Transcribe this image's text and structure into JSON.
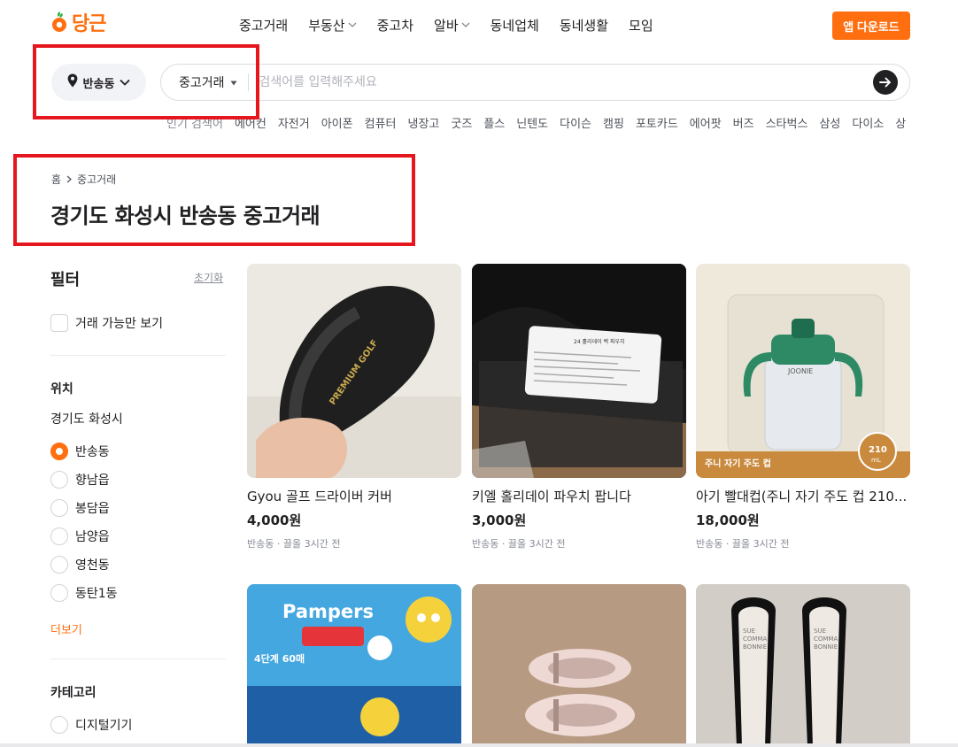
{
  "header": {
    "logo_text": "당근",
    "nav": [
      {
        "label": "중고거래",
        "has_chevron": false
      },
      {
        "label": "부동산",
        "has_chevron": true
      },
      {
        "label": "중고차",
        "has_chevron": false
      },
      {
        "label": "알바",
        "has_chevron": true
      },
      {
        "label": "동네업체",
        "has_chevron": false
      },
      {
        "label": "동네생활",
        "has_chevron": false
      },
      {
        "label": "모임",
        "has_chevron": false
      }
    ],
    "app_download_label": "앱 다운로드"
  },
  "search": {
    "location_label": "반송동",
    "category_label": "중고거래",
    "placeholder": "검색어를 입력해주세요",
    "popular": [
      "인기 검색어",
      "에어컨",
      "자전거",
      "아이폰",
      "컴퓨터",
      "냉장고",
      "굿즈",
      "플스",
      "닌텐도",
      "다이슨",
      "캠핑",
      "포토카드",
      "에어팟",
      "버즈",
      "스타벅스",
      "삼성",
      "다이소",
      "상품권"
    ]
  },
  "breadcrumb": {
    "home": "홈",
    "current": "중고거래"
  },
  "page_title": "경기도 화성시 반송동 중고거래",
  "sidebar": {
    "filter_title": "필터",
    "reset_label": "초기화",
    "available_only_label": "거래 가능만 보기",
    "location_title": "위치",
    "city": "경기도 화성시",
    "neighborhoods": [
      {
        "label": "반송동",
        "selected": true
      },
      {
        "label": "향남읍",
        "selected": false
      },
      {
        "label": "봉담읍",
        "selected": false
      },
      {
        "label": "남양읍",
        "selected": false
      },
      {
        "label": "영천동",
        "selected": false
      },
      {
        "label": "동탄1동",
        "selected": false
      }
    ],
    "more_label": "더보기",
    "category_title": "카테고리",
    "categories": [
      {
        "label": "디지털기기"
      }
    ]
  },
  "products": [
    {
      "title": "Gyou 골프 드라이버 커버",
      "price": "4,000원",
      "meta": "반송동 · 끌올 3시간 전",
      "image": "golf-cover"
    },
    {
      "title": "키엘 홀리데이 파우치 팝니다",
      "price": "3,000원",
      "meta": "반송동 · 끌올 3시간 전",
      "image": "pouch"
    },
    {
      "title": "아기 빨대컵(주니 자기 주도 컵 210...",
      "price": "18,000원",
      "meta": "반송동 · 끌올 3시간 전",
      "image": "straw-cup"
    },
    {
      "title": "",
      "price": "",
      "meta": "",
      "image": "diapers"
    },
    {
      "title": "",
      "price": "",
      "meta": "",
      "image": "ballet-shoes"
    },
    {
      "title": "",
      "price": "",
      "meta": "",
      "image": "heels"
    }
  ],
  "image_text": {
    "golf": "PREMIUM GOLF",
    "pouch_label": "24 홀리데이 백 파우치",
    "cup_brand": "JOONIE",
    "cup_label": "주니 자기 주도 컵",
    "cup_size": "210",
    "cup_unit": "mL",
    "diaper_brand": "Pampers",
    "diaper_size": "4단계 60매",
    "shoe_brand_1": "SUE",
    "shoe_brand_2": "COMMA",
    "shoe_brand_3": "BONNIE"
  },
  "colors": {
    "brand": "#ff6f0f",
    "annotation": "#e5161d"
  }
}
